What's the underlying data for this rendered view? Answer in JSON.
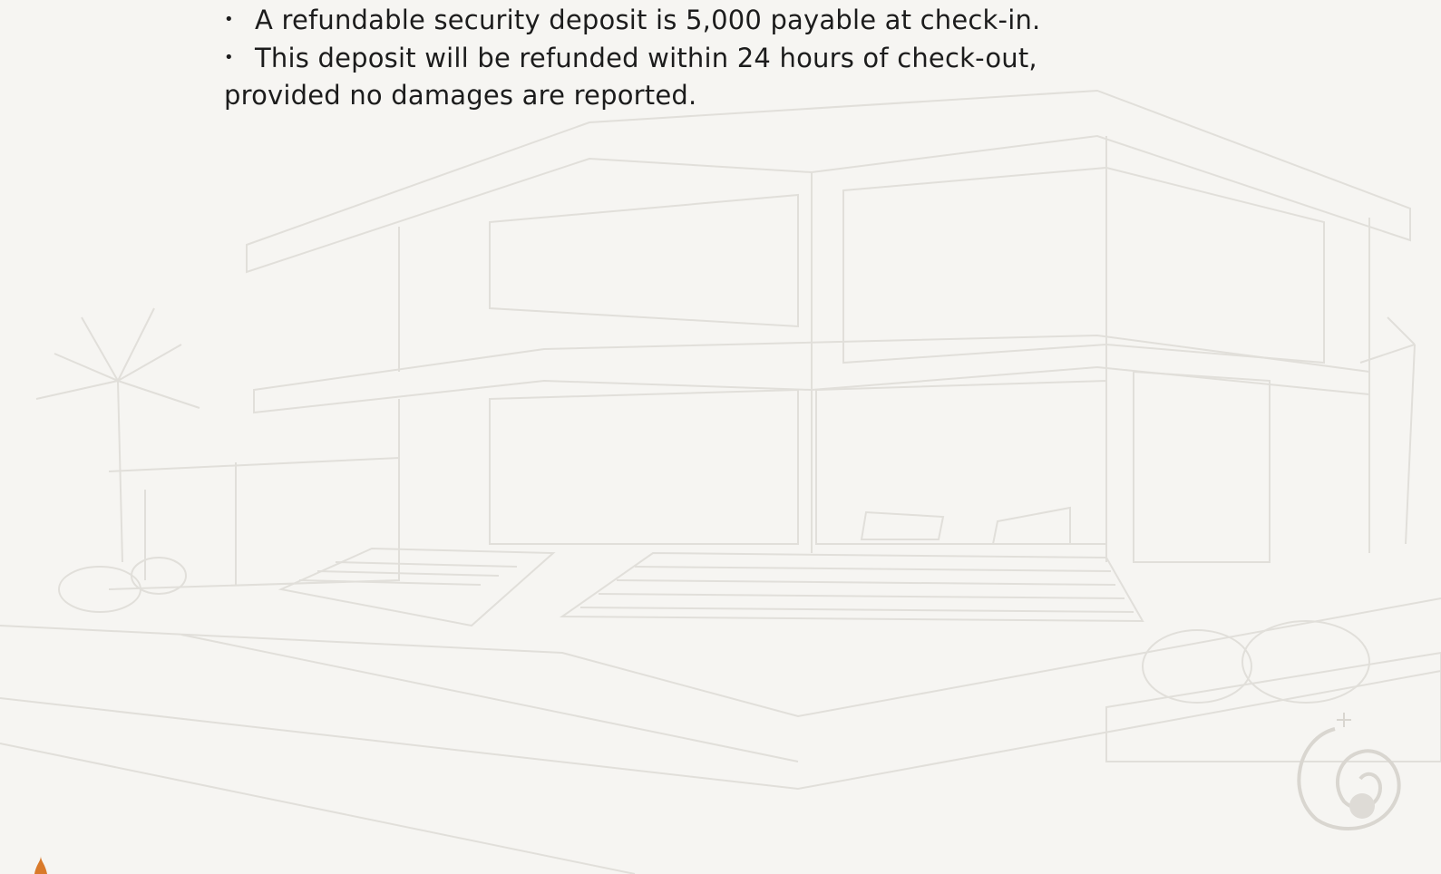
{
  "document": {
    "bullets": [
      {
        "marker": "•",
        "text": "A refundable security deposit is 5,000 payable at check-in."
      },
      {
        "marker": "•",
        "text": "This deposit will be refunded within 24 hours of check-out,",
        "continuation": "provided no damages are reported."
      }
    ]
  },
  "background": {
    "description_icon": "villa-sketch-illustration",
    "logo_icon": "spiral-shell-logo-icon",
    "corner_icon": "flame-icon"
  },
  "colors": {
    "page_bg": "#f6f5f2",
    "text": "#1c1c1c",
    "sketch_line": "#dcdad5",
    "accent": "#d97a2b"
  }
}
